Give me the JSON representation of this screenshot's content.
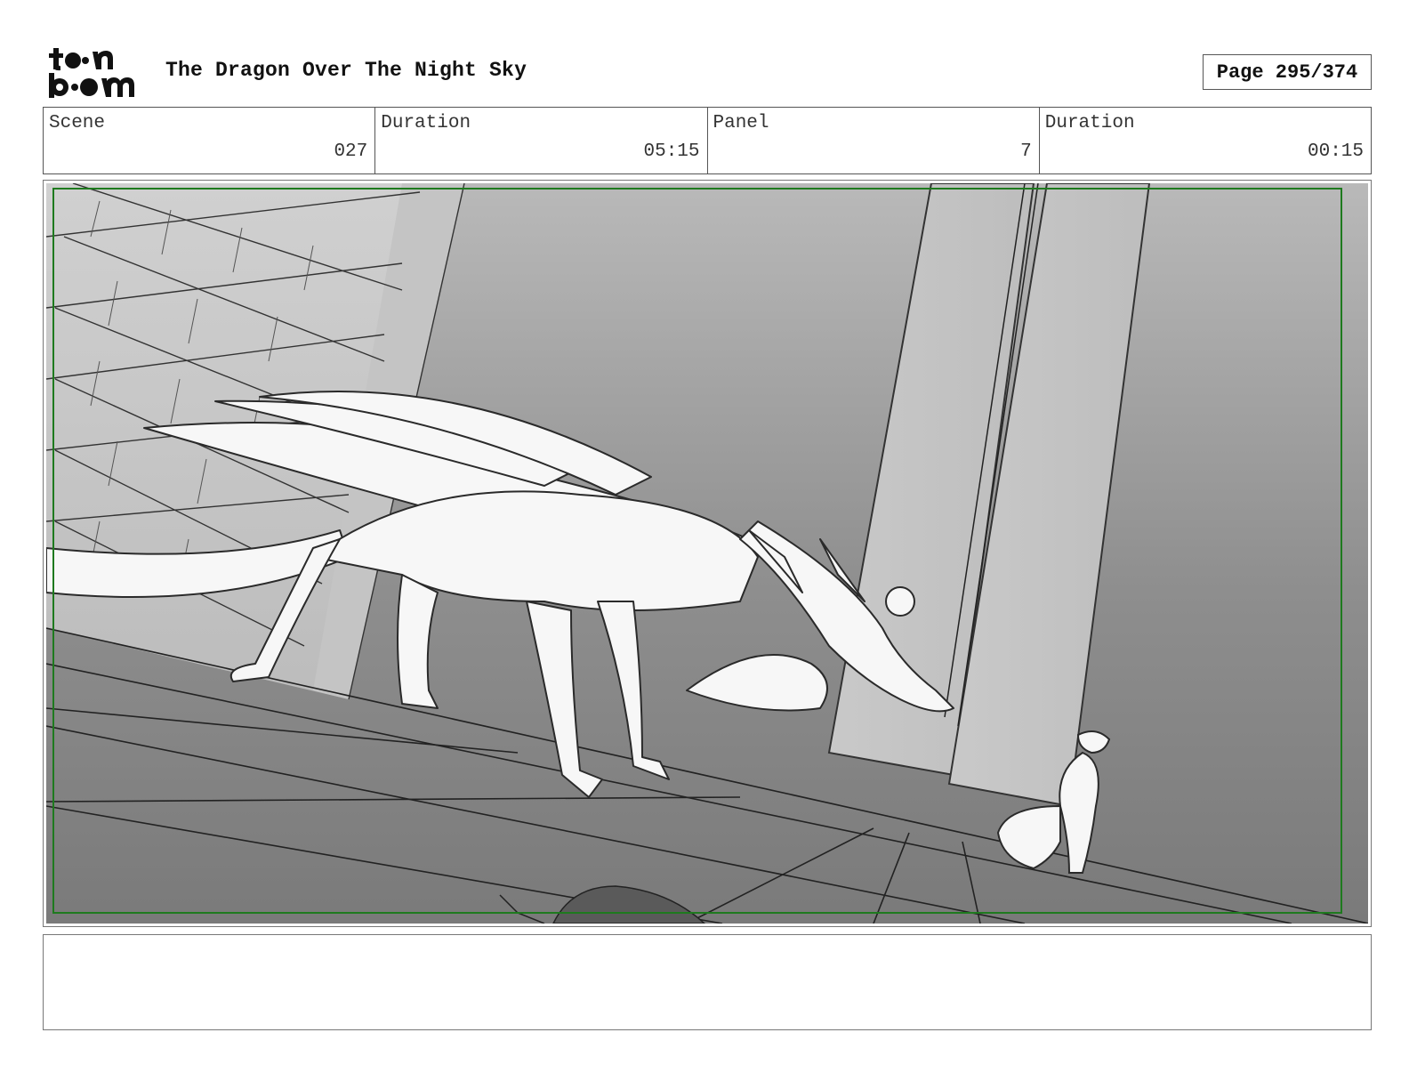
{
  "header": {
    "logo_text": "toon boom",
    "title": "The Dragon Over The Night Sky",
    "page_label": "Page 295/374"
  },
  "info": {
    "scene_label": "Scene",
    "scene_value": "027",
    "scene_duration_label": "Duration",
    "scene_duration_value": "05:15",
    "panel_label": "Panel",
    "panel_value": "7",
    "panel_duration_label": "Duration",
    "panel_duration_value": "00:15"
  },
  "panel": {
    "image_icon": "storyboard-sketch-dragon-and-girl",
    "safe_frame_color": "#1e7a1e"
  },
  "notes": {
    "text": ""
  }
}
